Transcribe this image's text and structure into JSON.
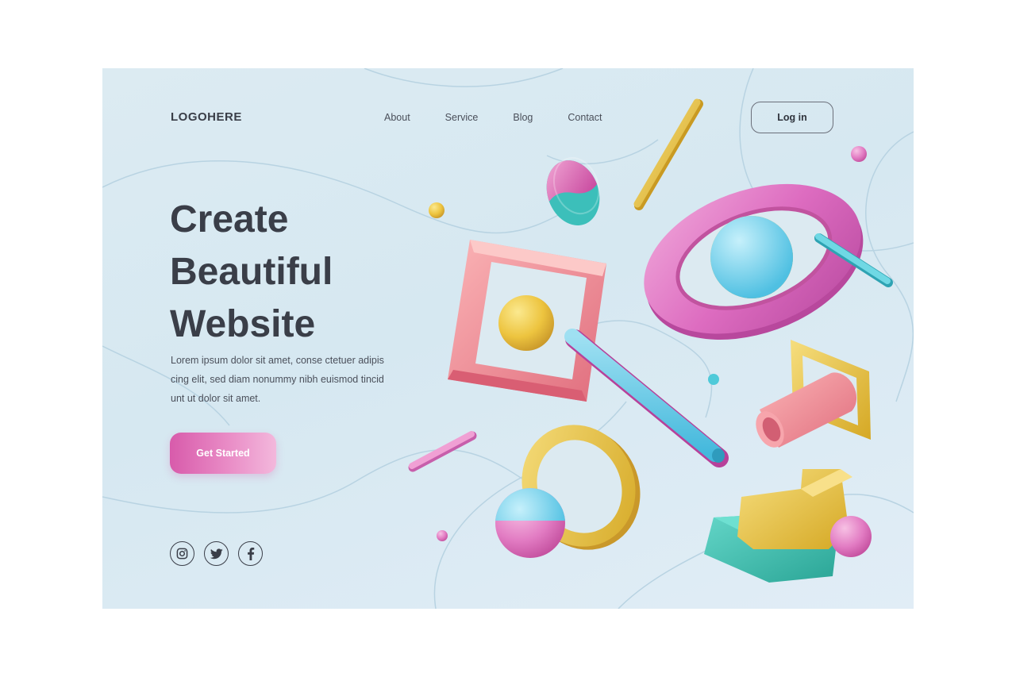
{
  "header": {
    "logo": "LOGOHERE",
    "nav": [
      {
        "label": "About"
      },
      {
        "label": "Service"
      },
      {
        "label": "Blog"
      },
      {
        "label": "Contact"
      }
    ],
    "login_label": "Log in"
  },
  "hero": {
    "title_lines": [
      "Create",
      "Beautiful",
      "Website"
    ],
    "description_lines": [
      "Lorem ipsum dolor sit amet, conse ctetuer adipis",
      "cing elit, sed diam nonummy nibh euismod tincid",
      "unt ut dolor sit amet."
    ],
    "cta_label": "Get Started"
  },
  "socials": [
    {
      "icon": "instagram-icon"
    },
    {
      "icon": "twitter-icon"
    },
    {
      "icon": "facebook-icon"
    }
  ],
  "colors": {
    "background": "#dcebf2",
    "text_dark": "#3a3e48",
    "accent_pink": "#e07bbd",
    "accent_yellow": "#e8c23a",
    "accent_blue": "#5cc6e4",
    "accent_teal": "#3dbdb0",
    "accent_coral": "#f18c95"
  }
}
